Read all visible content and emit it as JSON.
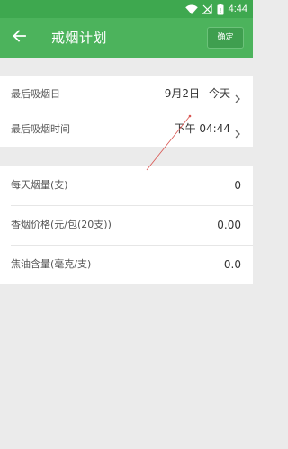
{
  "status_bar": {
    "time": "4:44"
  },
  "app_bar": {
    "title": "戒烟计划",
    "confirm_label": "确定"
  },
  "quit_section": {
    "rows": [
      {
        "label": "最后吸烟日",
        "value": "9月2日",
        "suffix": "今天"
      },
      {
        "label": "最后吸烟时间",
        "value": "下午 04:44"
      }
    ]
  },
  "habit_section": {
    "rows": [
      {
        "label": "每天烟量(支)",
        "value": "0"
      },
      {
        "label": "香烟价格(元/包(20支))",
        "value": "0.00"
      },
      {
        "label": "焦油含量(毫克/支)",
        "value": "0.0"
      }
    ]
  },
  "colors": {
    "status_bar": "#3ea84f",
    "app_bar": "#4cb35c",
    "page_bg": "#ebebeb",
    "card_bg": "#ffffff",
    "annotation": "#d9534f"
  },
  "icons": {
    "wifi": "wifi-icon",
    "signal": "no-signal-icon",
    "battery": "battery-icon",
    "back": "arrow-left-icon",
    "chevron": "chevron-right-icon"
  }
}
